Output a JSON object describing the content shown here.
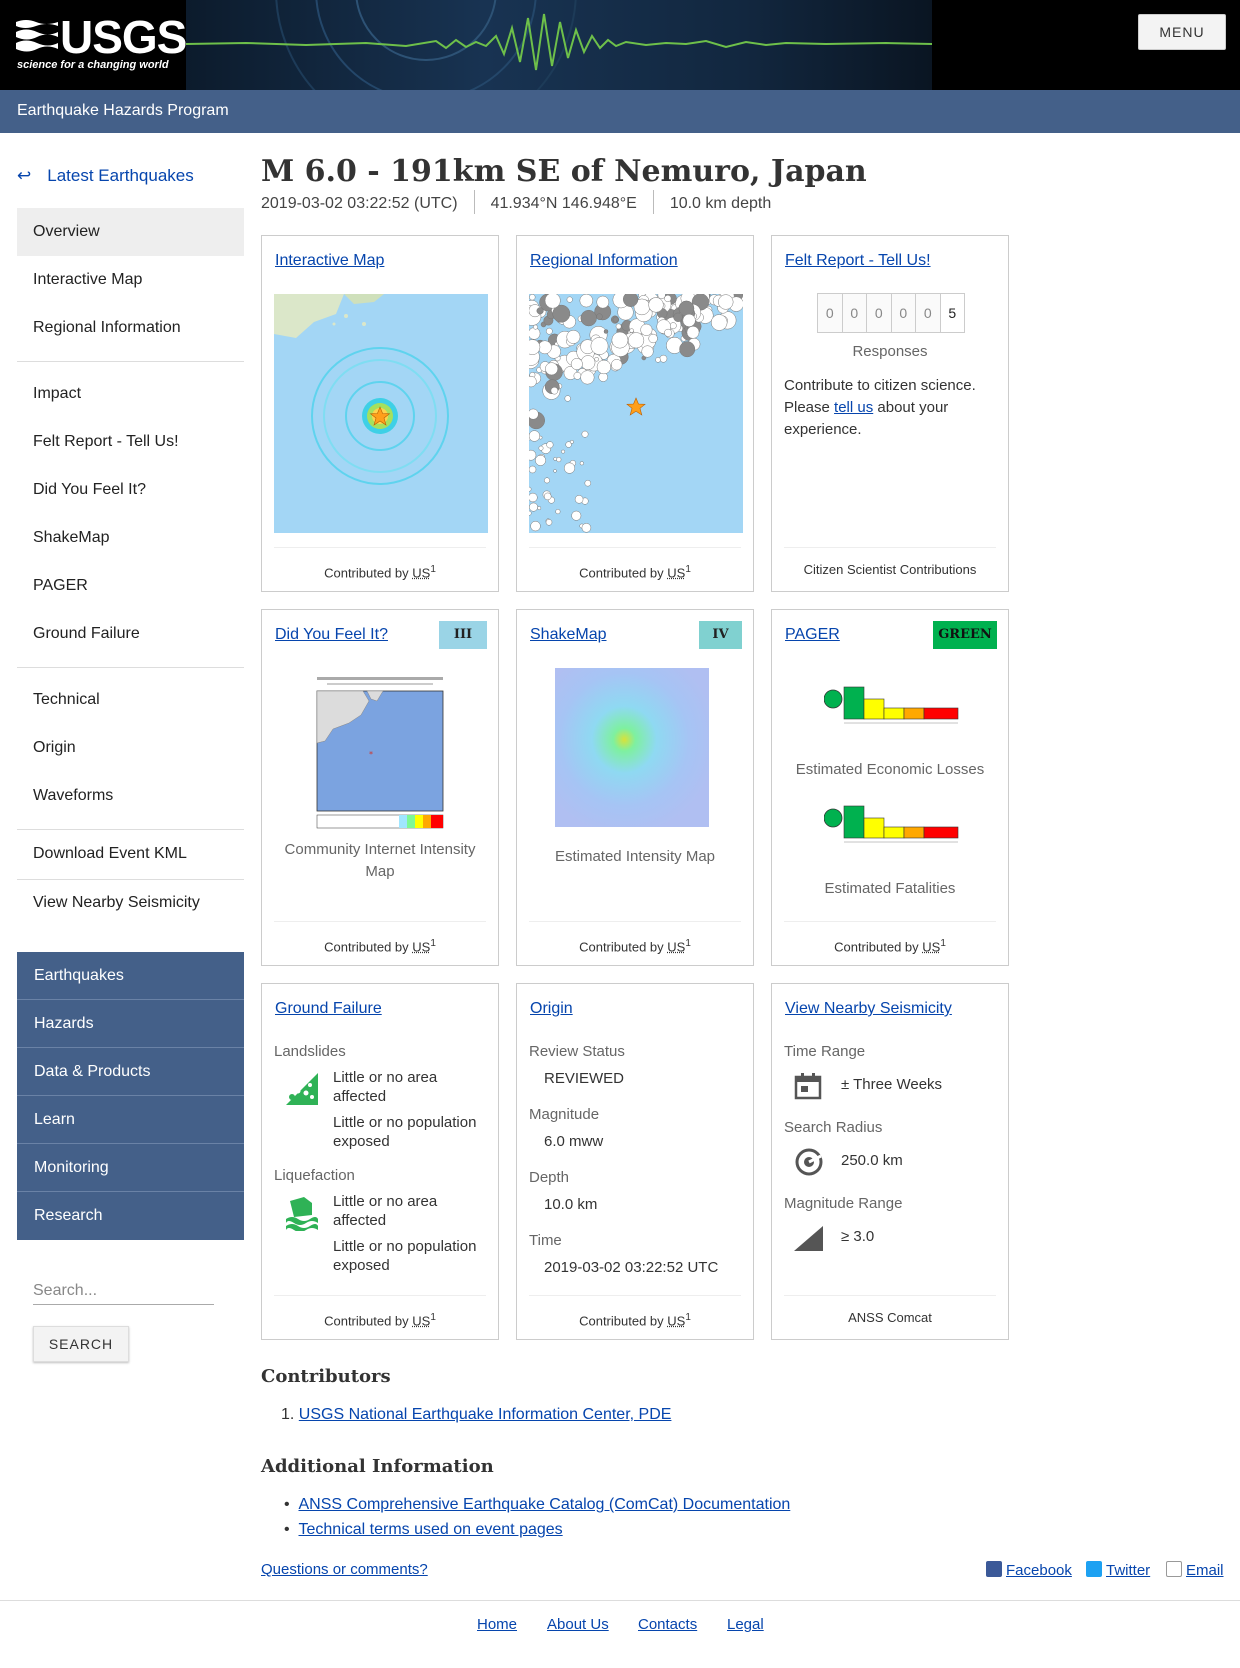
{
  "header": {
    "logo_text": "USGS",
    "logo_tagline": "science for a changing world",
    "menu_label": "MENU",
    "program_title": "Earthquake Hazards Program"
  },
  "sidebar": {
    "back_link": "Latest Earthquakes",
    "nav_groups": [
      [
        "Overview",
        "Interactive Map",
        "Regional Information"
      ],
      [
        "Impact",
        "Felt Report - Tell Us!",
        "Did You Feel It?",
        "ShakeMap",
        "PAGER",
        "Ground Failure"
      ],
      [
        "Technical",
        "Origin",
        "Waveforms"
      ],
      [
        "Download Event KML"
      ],
      [
        "View Nearby Seismicity"
      ]
    ],
    "active_item": "Overview",
    "site_nav": [
      "Earthquakes",
      "Hazards",
      "Data & Products",
      "Learn",
      "Monitoring",
      "Research"
    ],
    "search_placeholder": "Search...",
    "search_button": "SEARCH"
  },
  "event": {
    "title": "M 6.0 - 191km SE of Nemuro, Japan",
    "time": "2019-03-02 03:22:52 (UTC)",
    "location": "41.934°N 146.948°E",
    "depth": "10.0 km depth"
  },
  "cards": {
    "interactive_map": {
      "link": "Interactive Map",
      "contrib": "Contributed by",
      "contrib_net": "US",
      "contrib_ref": "1"
    },
    "regional": {
      "link": "Regional Information",
      "contrib": "Contributed by",
      "contrib_net": "US",
      "contrib_ref": "1"
    },
    "felt": {
      "link": "Felt Report - Tell Us!",
      "digits": [
        "0",
        "0",
        "0",
        "0",
        "0",
        "5"
      ],
      "responses_label": "Responses",
      "text_before": "Contribute to citizen science. Please ",
      "text_link": "tell us",
      "text_after": " about your experience.",
      "footer": "Citizen Scientist Contributions"
    },
    "dyfi": {
      "link": "Did You Feel It?",
      "badge": "III",
      "badge_color": "#9ad4e6",
      "caption": "Community Internet Intensity Map",
      "contrib": "Contributed by",
      "contrib_net": "US",
      "contrib_ref": "1"
    },
    "shakemap": {
      "link": "ShakeMap",
      "badge": "IV",
      "badge_color": "#80d1d0",
      "caption": "Estimated Intensity Map",
      "contrib": "Contributed by",
      "contrib_net": "US",
      "contrib_ref": "1"
    },
    "pager": {
      "link": "PAGER",
      "badge": "GREEN",
      "badge_color": "#00b14f",
      "economic_caption": "Estimated Economic Losses",
      "fatalities_caption": "Estimated Fatalities",
      "contrib": "Contributed by",
      "contrib_net": "US",
      "contrib_ref": "1"
    },
    "ground_failure": {
      "link": "Ground Failure",
      "landslides_label": "Landslides",
      "landslides_area": "Little or no area affected",
      "landslides_pop": "Little or no population exposed",
      "liquefaction_label": "Liquefaction",
      "liquefaction_area": "Little or no area affected",
      "liquefaction_pop": "Little or no population exposed",
      "contrib": "Contributed by",
      "contrib_net": "US",
      "contrib_ref": "1"
    },
    "origin": {
      "link": "Origin",
      "review_label": "Review Status",
      "review_value": "REVIEWED",
      "magnitude_label": "Magnitude",
      "magnitude_value": "6.0 mww",
      "depth_label": "Depth",
      "depth_value": "10.0 km",
      "time_label": "Time",
      "time_value": "2019-03-02 03:22:52 UTC",
      "contrib": "Contributed by",
      "contrib_net": "US",
      "contrib_ref": "1"
    },
    "seismicity": {
      "link": "View Nearby Seismicity",
      "time_range_label": "Time Range",
      "time_range_value": "± Three Weeks",
      "radius_label": "Search Radius",
      "radius_value": "250.0 km",
      "mag_range_label": "Magnitude Range",
      "mag_range_value": "≥ 3.0",
      "footer": "ANSS Comcat"
    }
  },
  "contributors": {
    "title": "Contributors",
    "items": [
      {
        "num": "1.",
        "text": "USGS National Earthquake Information Center, PDE"
      }
    ]
  },
  "additional": {
    "title": "Additional Information",
    "items": [
      "ANSS Comprehensive Earthquake Catalog (ComCat) Documentation",
      "Technical terms used on event pages"
    ]
  },
  "feedback": {
    "questions": "Questions or comments?",
    "facebook": "Facebook",
    "twitter": "Twitter",
    "email": "Email"
  },
  "footer": {
    "links": [
      "Home",
      "About Us",
      "Contacts",
      "Legal"
    ]
  }
}
